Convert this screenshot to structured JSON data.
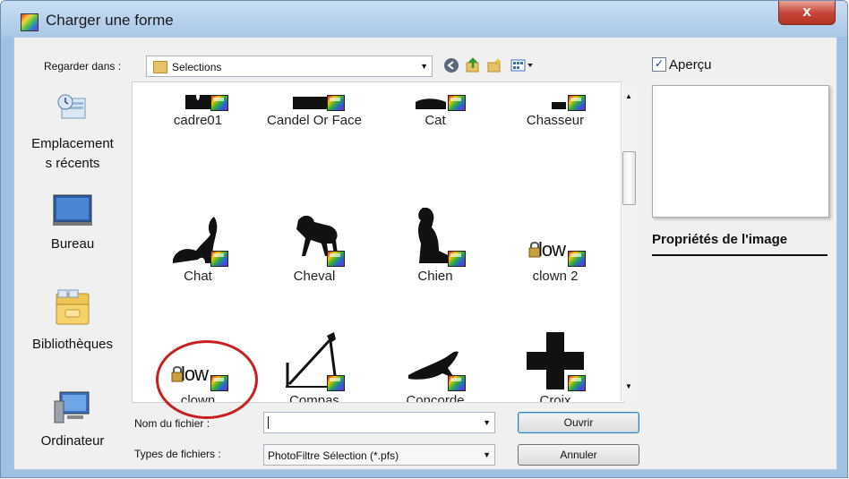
{
  "window": {
    "title": "Charger une forme",
    "close_glyph": "x"
  },
  "toolbar": {
    "look_in_label": "Regarder dans :",
    "look_in_value": "Selections",
    "icons": [
      "back-icon",
      "up-folder-icon",
      "new-folder-icon",
      "view-menu-icon"
    ]
  },
  "places": [
    {
      "label": "Emplacements récents",
      "label_line1": "Emplacement",
      "label_line2": "s récents",
      "icon": "recent-places-icon"
    },
    {
      "label": "Bureau",
      "icon": "desktop-icon"
    },
    {
      "label": "Bibliothèques",
      "icon": "libraries-icon"
    },
    {
      "label": "Ordinateur",
      "icon": "computer-icon"
    }
  ],
  "files": [
    {
      "name": "cadre01"
    },
    {
      "name": "Candel Or Face"
    },
    {
      "name": "Cat"
    },
    {
      "name": "Chasseur"
    },
    {
      "name": "Chat"
    },
    {
      "name": "Cheval"
    },
    {
      "name": "Chien"
    },
    {
      "name": "clown 2"
    },
    {
      "name": "clown"
    },
    {
      "name": "Compas"
    },
    {
      "name": "Concorde"
    },
    {
      "name": "Croix"
    }
  ],
  "clown_thumb_text": "low",
  "preview": {
    "checkbox_label": "Aperçu",
    "checked": true,
    "properties_title": "Propriétés de l'image"
  },
  "footer": {
    "filename_label": "Nom du fichier :",
    "filename_value": "",
    "filetype_label": "Types de fichiers :",
    "filetype_value": "PhotoFiltre Sélection (*.pfs)",
    "open_button": "Ouvrir",
    "cancel_button": "Annuler"
  },
  "colors": {
    "highlight_circle": "#c82020",
    "titlebar": "#a9c7e7",
    "close": "#c7473a"
  }
}
